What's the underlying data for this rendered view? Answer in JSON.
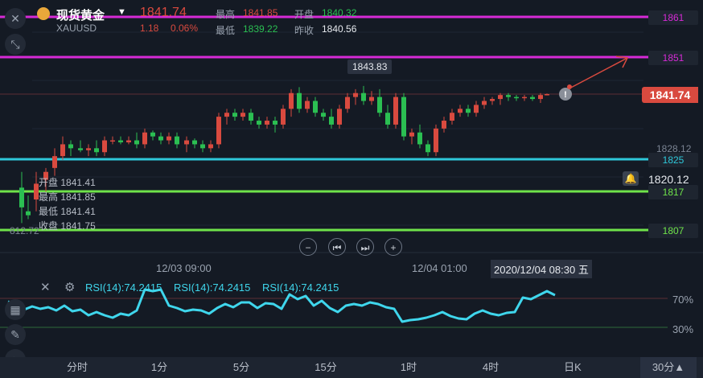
{
  "instrument": {
    "name": "现货黄金",
    "symbol": "XAUUSD",
    "price": "1841.74",
    "change": "1.18",
    "change_pct": "0.06%",
    "high_label": "最高",
    "high": "1841.85",
    "open_label": "开盘",
    "open": "1840.32",
    "low_label": "最低",
    "low": "1839.22",
    "prev_close_label": "昨收",
    "prev_close": "1840.56"
  },
  "chart": {
    "level_lines": [
      {
        "value": "1861",
        "color": "#d62ad6"
      },
      {
        "value": "1851",
        "color": "#d62ad6"
      },
      {
        "value": "1825",
        "color": "#2ec7d9"
      },
      {
        "value": "1817",
        "color": "#6fe34a"
      },
      {
        "value": "1807",
        "color": "#6fe34a"
      }
    ],
    "current_price_tag": "1841.74",
    "high_annotation": "1843.83",
    "axis_label_1828": "1828.12",
    "alert_price": "1820.12",
    "left_cut_label": "812.72",
    "ohlc_box": {
      "open_label": "开盘",
      "open": "1841.41",
      "high_label": "最高",
      "high": "1841.85",
      "low_label": "最低",
      "low": "1841.41",
      "close_label": "收盘",
      "close": "1841.75"
    },
    "time_labels": [
      "12/03 09:00",
      "12/04 01:00"
    ],
    "crosshair_time": "2020/12/04 08:30 五"
  },
  "rsi": {
    "labels": [
      "RSI(14):74.2415",
      "RSI(14):74.2415",
      "RSI(14):74.2415"
    ],
    "level_high": "70%",
    "level_low": "30%",
    "line_color": "#3fd6ec"
  },
  "tabs": [
    "分时",
    "1分",
    "5分",
    "15分",
    "1时",
    "4时",
    "日K"
  ],
  "period_selector": "30分▲",
  "colors": {
    "up": "#d94a3f",
    "down": "#2bbf52",
    "accent": "#d94a3f"
  }
}
